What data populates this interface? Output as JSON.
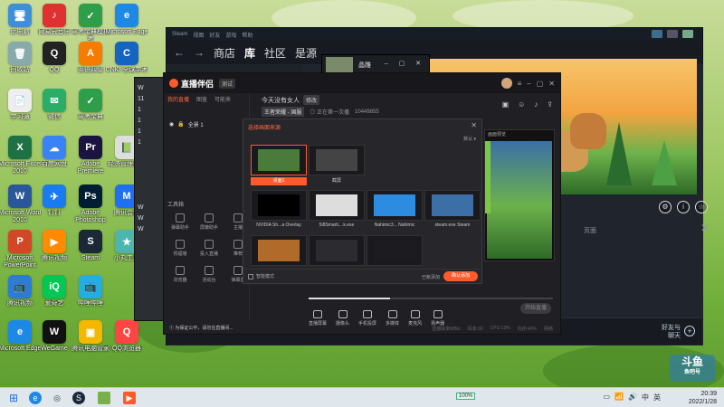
{
  "desktop_icons": [
    {
      "label": "此电脑",
      "color": "#3f8fd8",
      "glyph": "🖥"
    },
    {
      "label": "网易云音乐",
      "color": "#e03131",
      "glyph": "♪"
    },
    {
      "label": "驾考宝典模拟考",
      "color": "#2e9e4b",
      "glyph": "✓"
    },
    {
      "label": "Microsoft Edge",
      "color": "#1e88e5",
      "glyph": "e"
    },
    {
      "label": "回收站",
      "color": "#8aa",
      "glyph": "🗑"
    },
    {
      "label": "QQ",
      "color": "#222",
      "glyph": "Q"
    },
    {
      "label": "英语四级",
      "color": "#f57c00",
      "glyph": "A"
    },
    {
      "label": "CNKI 全球学术",
      "color": "#1565c0",
      "glyph": "C"
    },
    {
      "label": "学习通",
      "color": "#eee",
      "glyph": "📄"
    },
    {
      "label": "微信",
      "color": "#2aae67",
      "glyph": "✉"
    },
    {
      "label": "驾考宝典",
      "color": "#2e9e4b",
      "glyph": "✓"
    },
    {
      "label": "Microsoft Excel 2010",
      "color": "#1e7145",
      "glyph": "X"
    },
    {
      "label": "百度网盘",
      "color": "#3a82f7",
      "glyph": "☁"
    },
    {
      "label": "Adobe Premiere",
      "color": "#1b1340",
      "glyph": "Pr"
    },
    {
      "label": "经济管理会计",
      "color": "#ddd",
      "glyph": "📗"
    },
    {
      "label": "Microsoft Word 2010",
      "color": "#2b579a",
      "glyph": "W"
    },
    {
      "label": "钉钉",
      "color": "#1a7bf0",
      "glyph": "✈"
    },
    {
      "label": "Adobe Photoshop",
      "color": "#001d34",
      "glyph": "Ps"
    },
    {
      "label": "腾讯会议",
      "color": "#1f6ff2",
      "glyph": "M"
    },
    {
      "label": "Microsoft PowerPoint",
      "color": "#d24726",
      "glyph": "P"
    },
    {
      "label": "腾讯视频",
      "color": "#ff8a00",
      "glyph": "▶"
    },
    {
      "label": "Steam",
      "color": "#1b2838",
      "glyph": "S"
    },
    {
      "label": "小丸工具",
      "color": "#4db6ac",
      "glyph": "★"
    },
    {
      "label": "腾讯视频",
      "color": "#2e7bd6",
      "glyph": "📺"
    },
    {
      "label": "爱奇艺",
      "color": "#00c853",
      "glyph": "iQ"
    },
    {
      "label": "哔哩哔哩",
      "color": "#23ade5",
      "glyph": "📺"
    },
    {
      "label": "Microsoft Edge",
      "color": "#1e88e5",
      "glyph": "e"
    },
    {
      "label": "WeGame",
      "color": "#111",
      "glyph": "W"
    },
    {
      "label": "腾讯电脑管家",
      "color": "#f5b800",
      "glyph": "▣"
    },
    {
      "label": "QQ浏览器",
      "color": "#f44",
      "glyph": "Q"
    }
  ],
  "steam": {
    "nav": [
      "商店",
      "库",
      "社区",
      "是源"
    ],
    "bottom_friends": "好友与\n聊天",
    "label_pv": "页面",
    "titlebar": [
      "Steam",
      "视图",
      "好友",
      "游戏",
      "帮助"
    ]
  },
  "overlay_window": {
    "title": "晶雕"
  },
  "chat_window": {
    "rows": [
      "W",
      "11",
      "1",
      "1",
      "1",
      "1",
      "W",
      "W",
      "W"
    ]
  },
  "zb": {
    "logo": "直播伴侣",
    "version": "测试",
    "tabs": [
      "我的直播",
      "图鉴",
      "可能来"
    ],
    "title": "今天没有女人",
    "edit": "修改",
    "tag": "王者荣耀 - 国服",
    "sub2": "◎ 正在第一次播",
    "sub3": "10449855",
    "scene_add": "+",
    "scene": "全景 1",
    "tools_header": "工具箱",
    "tools": [
      "弹幕助手",
      "屏蔽助手",
      "主播",
      "祝福墙",
      "投入直播",
      "推荐",
      "浏览器",
      "活动台",
      "弹幕盒"
    ],
    "bottom": [
      "直播屏幕",
      "摄像头",
      "手机投屏",
      "多媒体",
      "麦克风",
      "扬声器"
    ],
    "start": "开始直播",
    "notice": "① 为保证公平，请勿在直播间...",
    "stats": [
      "直播帧率MB/s",
      "码率:00",
      "CPU:13%",
      "内存:40%",
      "网络"
    ]
  },
  "dialog": {
    "header": "选择画面来源",
    "default": "默认 ▾",
    "tiles": [
      {
        "caption": "桌面1",
        "selected": true,
        "color": "#4a7b3a"
      },
      {
        "caption": "截屏",
        "selected": false,
        "color": "#444"
      },
      {
        "caption": "NVIDIA Sh...a Overlay",
        "selected": false,
        "color": "#000"
      },
      {
        "caption": "5i8Smarti....k.exe",
        "selected": false,
        "color": "#ddd"
      },
      {
        "caption": "Nahimic3... Nahimic",
        "selected": false,
        "color": "#2d8be0"
      },
      {
        "caption": "steam.exe Steam",
        "selected": false,
        "color": "#3b6fa6"
      },
      {
        "caption": "",
        "selected": false,
        "color": "#b06a2a"
      },
      {
        "caption": "",
        "selected": false,
        "color": "#2b2b30"
      },
      {
        "caption": "",
        "selected": false,
        "color": "#1c1c20"
      }
    ],
    "checkbox": "智能模式",
    "cancel": "已帐添加",
    "ok": "确认添加"
  },
  "preview": {
    "top": "画面预览"
  },
  "watermark": {
    "title": "斗鱼",
    "sub": "鱼吧号"
  },
  "taskbar": {
    "battery": "100%",
    "time": "20:39",
    "date": "2022/1/28",
    "ime": "中",
    "lang": "英"
  }
}
